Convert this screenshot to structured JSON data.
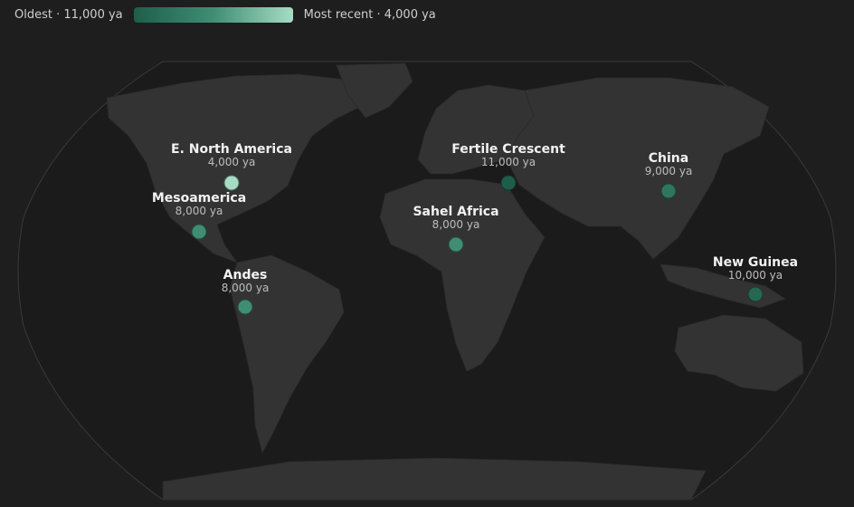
{
  "legend": {
    "oldest_label": "Oldest · 11,000 ya",
    "recent_label": "Most recent · 4,000 ya"
  },
  "sites": [
    {
      "name": "E. North America",
      "age": "4,000 ya",
      "years_ago": 4000,
      "color": "#a6dcc4"
    },
    {
      "name": "Mesoamerica",
      "age": "8,000 ya",
      "years_ago": 8000,
      "color": "#3f8e74"
    },
    {
      "name": "Andes",
      "age": "8,000 ya",
      "years_ago": 8000,
      "color": "#3f8e74"
    },
    {
      "name": "Fertile Crescent",
      "age": "11,000 ya",
      "years_ago": 11000,
      "color": "#1d5e4b"
    },
    {
      "name": "Sahel Africa",
      "age": "8,000 ya",
      "years_ago": 8000,
      "color": "#3f8e74"
    },
    {
      "name": "China",
      "age": "9,000 ya",
      "years_ago": 9000,
      "color": "#2f7661"
    },
    {
      "name": "New Guinea",
      "age": "10,000 ya",
      "years_ago": 10000,
      "color": "#25684f"
    }
  ]
}
